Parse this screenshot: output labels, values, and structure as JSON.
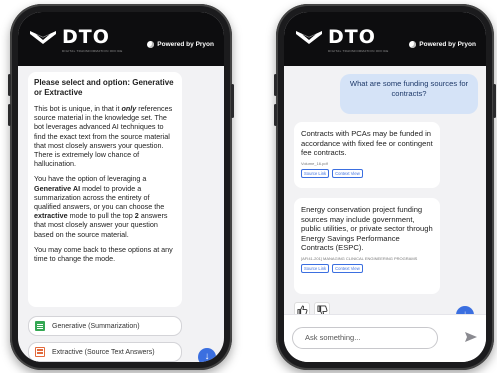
{
  "brand": {
    "name": "DTO",
    "tagline": "DIGITAL TRANSFORMATION OFFICE",
    "powered_by": "Powered by Pryon"
  },
  "left_screen": {
    "title": "Please select and option: Generative or Extractive",
    "p1_a": "This bot is unique, in that it ",
    "p1_em": "only",
    "p1_b": " references source material in the knowledge set. The bot leverages advanced AI techniques to find the exact text from the source material that most closely answers your question. There is extremely low chance of hallucination.",
    "p2_a": "You have the option of leveraging a ",
    "p2_b1": "Generative AI",
    "p2_c": " model to provide a summarization across the entirety of qualified answers, or you can choose the ",
    "p2_b2": "extractive",
    "p2_d": " mode to pull the top ",
    "p2_b3": "2",
    "p2_e": " answers that most closely answer your question based on the source material.",
    "p3": "You may come back to these options at any time to change the mode.",
    "option_generative": "Generative (Summarization)",
    "option_extractive": "Extractive (Source Text Answers)"
  },
  "right_screen": {
    "user_question": "What are some funding sources for contracts?",
    "answers": [
      {
        "text": "Contracts with PCAs may be funded in accordance with fixed fee or contingent fee contracts.",
        "source": "Volume_16.pdf",
        "source_link": "Source Link",
        "context_view": "Context View"
      },
      {
        "text": "Energy conservation project funding sources may include government, public utilities, or private sector through Energy Savings Performance Contracts (ESPC).",
        "source": "[AFI41-201] MANAGING CLINICAL ENGINEERING PROGRAMS",
        "source_link": "Source Link",
        "context_view": "Context View"
      }
    ],
    "input_placeholder": "Ask something..."
  },
  "colors": {
    "header_bg": "#0d0d0f",
    "accent": "#3b6fe0",
    "user_bubble": "#d5e3f7"
  },
  "icons": [
    "dto-logo-icon",
    "pryon-logo-icon",
    "generative-icon",
    "extractive-icon",
    "scroll-down-icon",
    "thumbs-up-icon",
    "thumbs-down-icon",
    "send-icon"
  ]
}
